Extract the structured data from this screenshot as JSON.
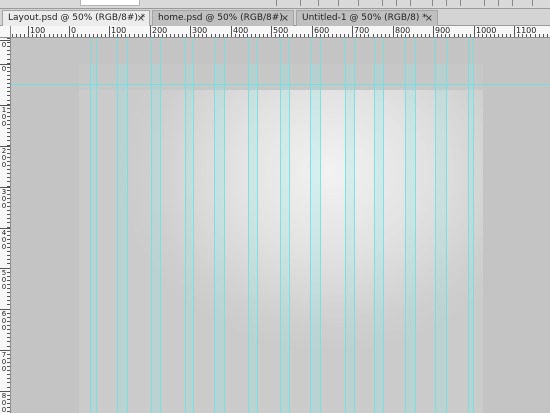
{
  "tabs": [
    {
      "label": "Layout.psd @ 50% (RGB/8#) *",
      "close": "×",
      "active": true
    },
    {
      "label": "home.psd @ 50% (RGB/8#)",
      "close": "×",
      "active": false
    },
    {
      "label": "Untitled-1 @ 50% (RGB/8) *",
      "close": "×",
      "active": false
    }
  ],
  "ruler_top_labels": [
    "100",
    "0",
    "100",
    "200",
    "300",
    "400",
    "500",
    "600",
    "700",
    "800",
    "900",
    "1000",
    "1100"
  ],
  "ruler_left_labels": [
    "0",
    "0",
    "100",
    "200",
    "300",
    "400",
    "500",
    "600",
    "700",
    "800"
  ],
  "colors": {
    "guide": "#74e0e0",
    "canvas_bg": "#c4c4c4",
    "ruler_bg": "#f7f7f7"
  },
  "icons": [
    "close-icon"
  ]
}
